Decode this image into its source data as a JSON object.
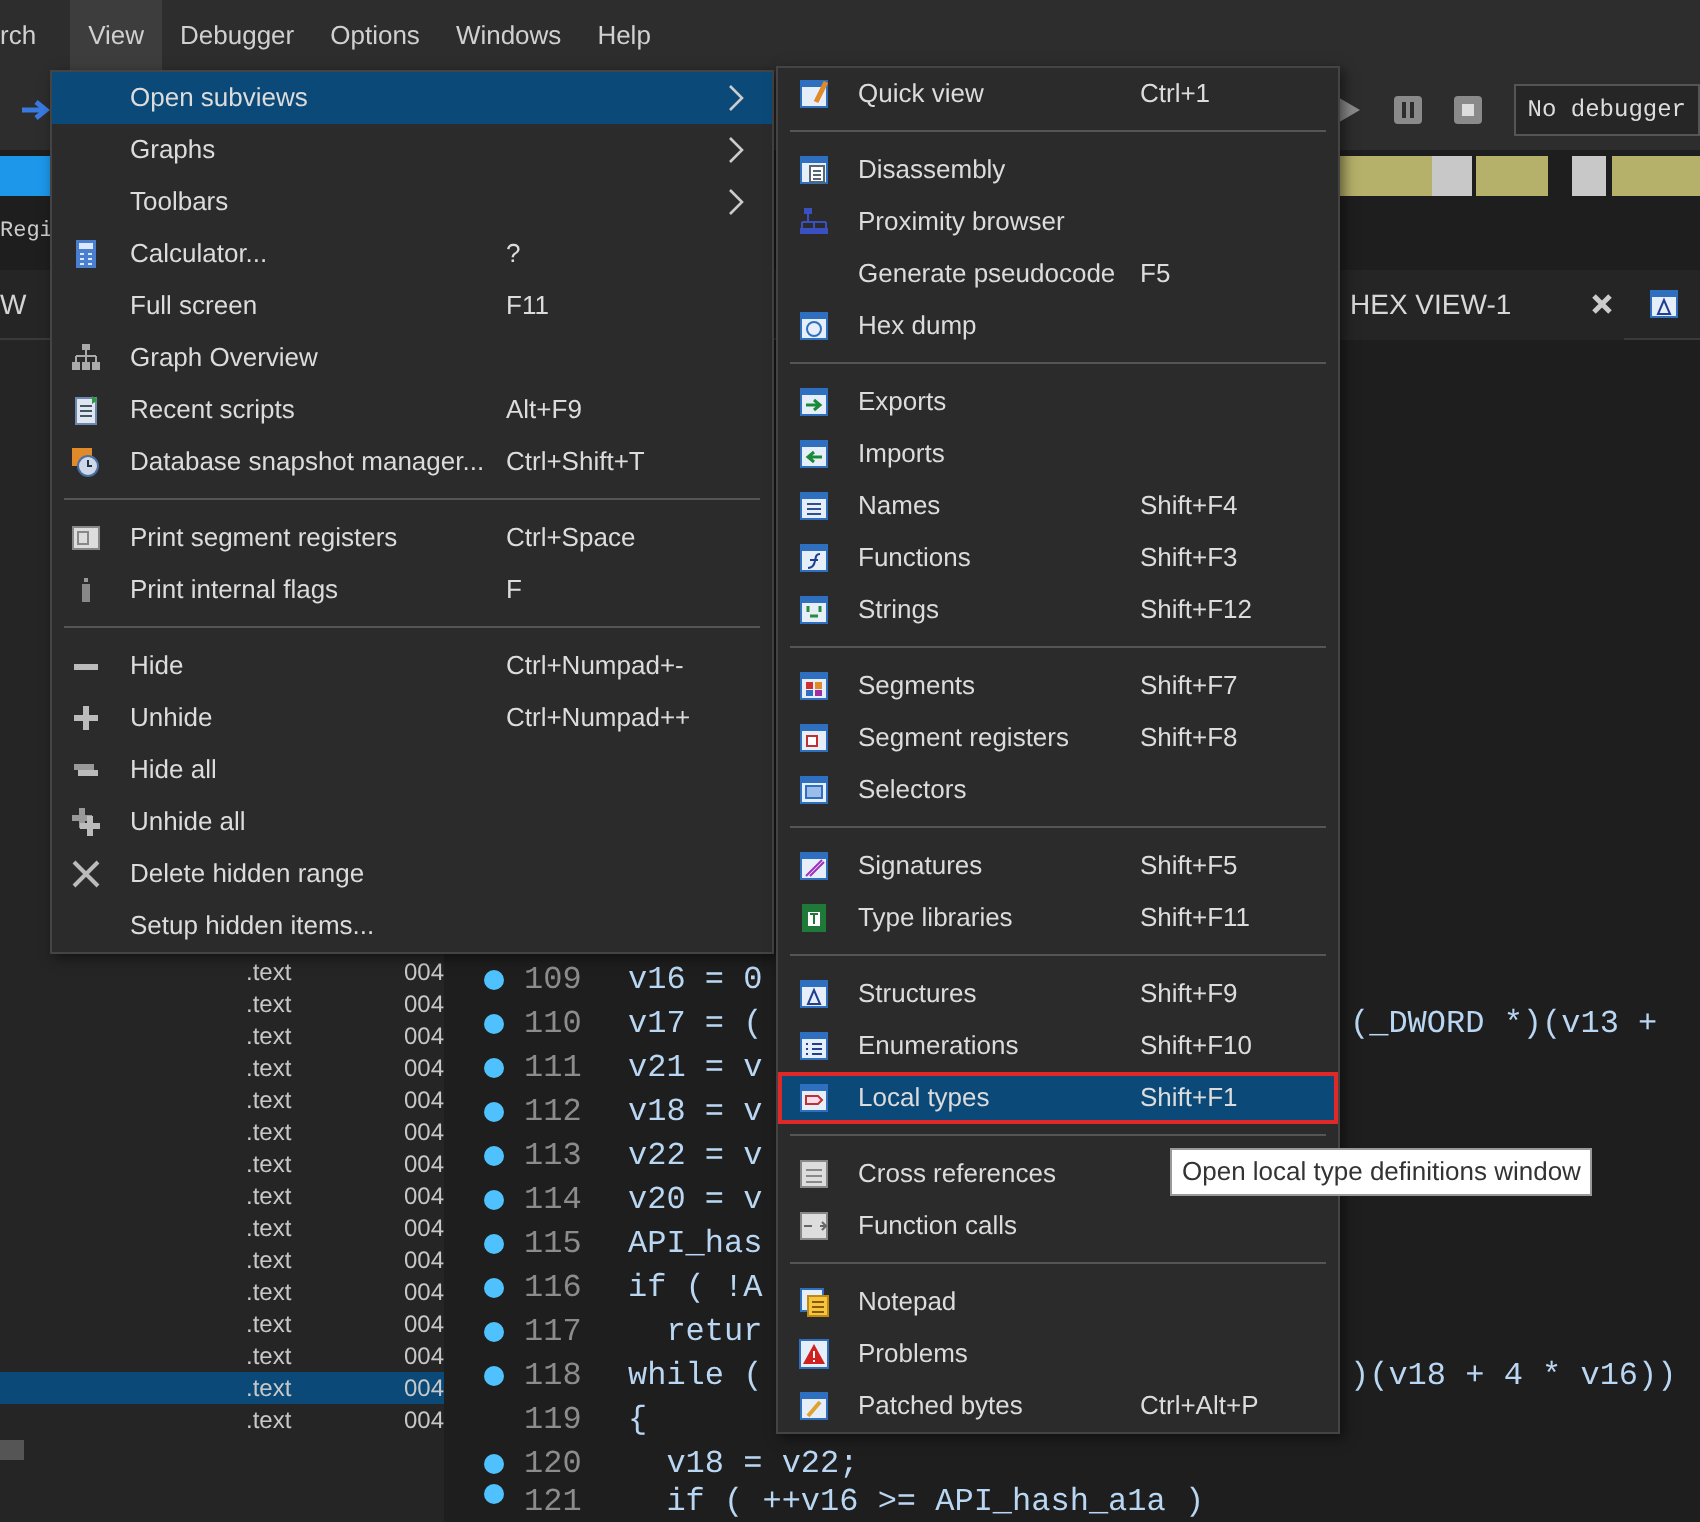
{
  "menu_bar": [
    {
      "label": "rch",
      "selected": false
    },
    {
      "label": "View",
      "selected": true
    },
    {
      "label": "Debugger",
      "selected": false
    },
    {
      "label": "Options",
      "selected": false
    },
    {
      "label": "Windows",
      "selected": false
    },
    {
      "label": "Help",
      "selected": false
    }
  ],
  "toolbar": {
    "debugger_field": "No debugger"
  },
  "info_bar": {
    "text": "Regi"
  },
  "tab_bar": {
    "left_tab": "W",
    "tabs": [
      {
        "label": "HEX VIEW-1"
      }
    ]
  },
  "segment_list": {
    "rows": [
      {
        "column_1": ".text",
        "column_2": "004",
        "selected": false
      },
      {
        "column_1": ".text",
        "column_2": "004",
        "selected": false
      },
      {
        "column_1": ".text",
        "column_2": "004",
        "selected": false
      },
      {
        "column_1": ".text",
        "column_2": "004",
        "selected": false
      },
      {
        "column_1": ".text",
        "column_2": "004",
        "selected": false
      },
      {
        "column_1": ".text",
        "column_2": "004",
        "selected": false
      },
      {
        "column_1": ".text",
        "column_2": "004",
        "selected": false
      },
      {
        "column_1": ".text",
        "column_2": "004",
        "selected": false
      },
      {
        "column_1": ".text",
        "column_2": "004",
        "selected": false
      },
      {
        "column_1": ".text",
        "column_2": "004",
        "selected": false
      },
      {
        "column_1": ".text",
        "column_2": "004",
        "selected": false
      },
      {
        "column_1": ".text",
        "column_2": "004",
        "selected": false
      },
      {
        "column_1": ".text",
        "column_2": "004",
        "selected": false
      },
      {
        "column_1": ".text",
        "column_2": "004",
        "selected": true
      },
      {
        "column_1": ".text",
        "column_2": "004",
        "selected": false
      }
    ]
  },
  "code": {
    "lines": [
      {
        "number": "109",
        "breakpoint": true,
        "text": "v16 = 0"
      },
      {
        "number": "110",
        "breakpoint": true,
        "text": "v17 = (",
        "right_text": "(_DWORD *)(v13 +"
      },
      {
        "number": "111",
        "breakpoint": true,
        "text": "v21 = v"
      },
      {
        "number": "112",
        "breakpoint": true,
        "text": "v18 = v"
      },
      {
        "number": "113",
        "breakpoint": true,
        "text": "v22 = v"
      },
      {
        "number": "114",
        "breakpoint": true,
        "text": "v20 = v"
      },
      {
        "number": "115",
        "breakpoint": true,
        "text": "API_has"
      },
      {
        "number": "116",
        "breakpoint": true,
        "text": "if ( !A"
      },
      {
        "number": "117",
        "breakpoint": true,
        "text": "  retur"
      },
      {
        "number": "118",
        "breakpoint": true,
        "text": "while (",
        "right_text": ")(v18 + 4 * v16))"
      },
      {
        "number": "119",
        "breakpoint": false,
        "text": "{"
      },
      {
        "number": "120",
        "breakpoint": true,
        "text": "  v18 = v22;"
      },
      {
        "number": "121",
        "breakpoint": true,
        "text": "  if ( ++v16 >= API_hash_a1a )"
      }
    ]
  },
  "view_menu": {
    "sections": [
      [
        {
          "label": "Open subviews",
          "submenu": true,
          "selected": true
        },
        {
          "label": "Graphs",
          "submenu": true,
          "selected": false
        },
        {
          "label": "Toolbars",
          "submenu": true,
          "selected": false
        },
        {
          "label": "Calculator...",
          "shortcut": "?",
          "submenu": false,
          "selected": false
        },
        {
          "label": "Full screen",
          "shortcut": "F11",
          "submenu": false,
          "selected": false
        },
        {
          "label": "Graph Overview",
          "submenu": false,
          "selected": false
        },
        {
          "label": "Recent scripts",
          "shortcut": "Alt+F9",
          "submenu": false,
          "selected": false
        },
        {
          "label": "Database snapshot manager...",
          "shortcut": "Ctrl+Shift+T",
          "submenu": false,
          "selected": false
        }
      ],
      [
        {
          "label": "Print segment registers",
          "shortcut": "Ctrl+Space",
          "submenu": false,
          "selected": false
        },
        {
          "label": "Print internal flags",
          "shortcut": "F",
          "submenu": false,
          "selected": false
        }
      ],
      [
        {
          "label": "Hide",
          "shortcut": "Ctrl+Numpad+-",
          "submenu": false,
          "selected": false
        },
        {
          "label": "Unhide",
          "shortcut": "Ctrl+Numpad++",
          "submenu": false,
          "selected": false
        },
        {
          "label": "Hide all",
          "submenu": false,
          "selected": false
        },
        {
          "label": "Unhide all",
          "submenu": false,
          "selected": false
        },
        {
          "label": "Delete hidden range",
          "submenu": false,
          "selected": false
        },
        {
          "label": "Setup hidden items...",
          "submenu": false,
          "selected": false
        }
      ]
    ]
  },
  "subviews_menu": {
    "sections": [
      [
        {
          "label": "Quick view",
          "shortcut": "Ctrl+1",
          "selected": false,
          "outlined": false
        }
      ],
      [
        {
          "label": "Disassembly",
          "selected": false,
          "outlined": false
        },
        {
          "label": "Proximity browser",
          "selected": false,
          "outlined": false
        },
        {
          "label": "Generate pseudocode",
          "shortcut": "F5",
          "selected": false,
          "outlined": false
        },
        {
          "label": "Hex dump",
          "selected": false,
          "outlined": false
        }
      ],
      [
        {
          "label": "Exports",
          "selected": false,
          "outlined": false
        },
        {
          "label": "Imports",
          "selected": false,
          "outlined": false
        },
        {
          "label": "Names",
          "shortcut": "Shift+F4",
          "selected": false,
          "outlined": false
        },
        {
          "label": "Functions",
          "shortcut": "Shift+F3",
          "selected": false,
          "outlined": false
        },
        {
          "label": "Strings",
          "shortcut": "Shift+F12",
          "selected": false,
          "outlined": false
        }
      ],
      [
        {
          "label": "Segments",
          "shortcut": "Shift+F7",
          "selected": false,
          "outlined": false
        },
        {
          "label": "Segment registers",
          "shortcut": "Shift+F8",
          "selected": false,
          "outlined": false
        },
        {
          "label": "Selectors",
          "selected": false,
          "outlined": false
        }
      ],
      [
        {
          "label": "Signatures",
          "shortcut": "Shift+F5",
          "selected": false,
          "outlined": false
        },
        {
          "label": "Type libraries",
          "shortcut": "Shift+F11",
          "selected": false,
          "outlined": false
        }
      ],
      [
        {
          "label": "Structures",
          "shortcut": "Shift+F9",
          "selected": false,
          "outlined": false
        },
        {
          "label": "Enumerations",
          "shortcut": "Shift+F10",
          "selected": false,
          "outlined": false
        },
        {
          "label": "Local types",
          "shortcut": "Shift+F1",
          "selected": true,
          "outlined": true
        }
      ],
      [
        {
          "label": "Cross references",
          "selected": false,
          "outlined": false
        },
        {
          "label": "Function calls",
          "selected": false,
          "outlined": false
        }
      ],
      [
        {
          "label": "Notepad",
          "selected": false,
          "outlined": false
        },
        {
          "label": "Problems",
          "selected": false,
          "outlined": false
        },
        {
          "label": "Patched bytes",
          "shortcut": "Ctrl+Alt+P",
          "selected": false,
          "outlined": false
        }
      ]
    ]
  },
  "tooltip": {
    "text": "Open local type definitions window"
  }
}
